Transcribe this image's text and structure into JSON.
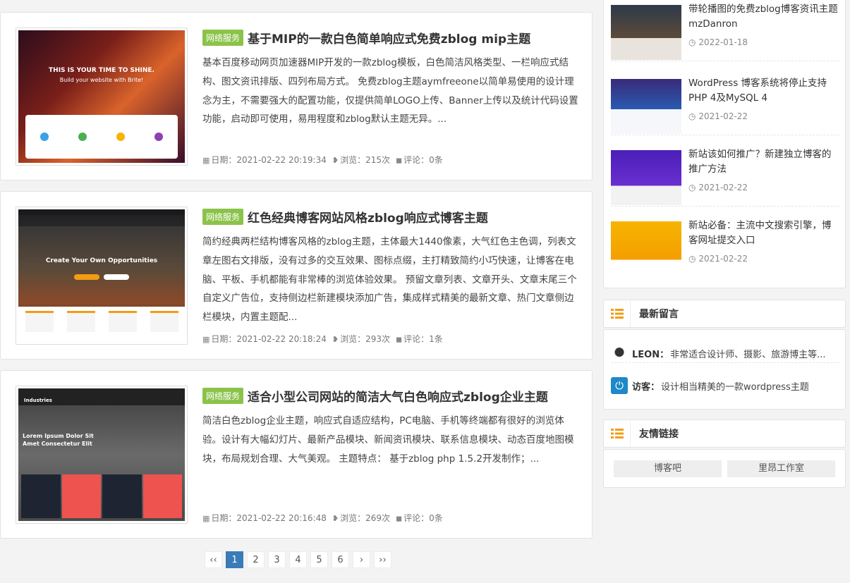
{
  "posts": [
    {
      "badge": "网络服务",
      "title": "基于MIP的一款白色简单响应式免费zblog mip主题",
      "excerpt": "基本百度移动网页加速器MIP开发的一款zblog模板，白色简洁风格类型、一栏响应式结构、图文资讯排版、四列布局方式。 免费zblog主题aymfreeone以简单易使用的设计理念为主，不需要强大的配置功能，仅提供简单LOGO上传、Banner上传以及统计代码设置功能，启动即可使用，易用程度和zblog默认主题无异。...",
      "date": "日期：2021-02-22 20:19:34",
      "views": "浏览：215次",
      "comments": "评论：0条",
      "thumb_text1": "THIS IS YOUR TIME TO SHINE.",
      "thumb_text2": "Build your website with Brite!"
    },
    {
      "badge": "网络服务",
      "title": "红色经典博客网站风格zblog响应式博客主题",
      "excerpt": "简约经典两栏结构博客风格的zblog主题，主体最大1440像素，大气红色主色调，列表文章左图右文排版，没有过多的交互效果、图标点缀，主打精致简约小巧快速，让博客在电脑、平板、手机都能有非常棒的浏览体验效果。 预留文章列表、文章开头、文章末尾三个自定义广告位，支持侧边栏新建模块添加广告，集成样式精美的最新文章、热门文章侧边栏模块，内置主题配...",
      "date": "日期：2021-02-22 20:18:24",
      "views": "浏览：293次",
      "comments": "评论：1条",
      "thumb_text1": "Create Your Own Opportunities"
    },
    {
      "badge": "网络服务",
      "title": "适合小型公司网站的简洁大气白色响应式zblog企业主题",
      "excerpt": "简洁白色zblog企业主题，响应式自适应结构，PC电脑、手机等终端都有很好的浏览体验。设计有大幅幻灯片、最新产品模块、新闻资讯模块、联系信息模块、动态百度地图模块，布局规划合理、大气美观。 主题特点： 基于zblog php 1.5.2开发制作；...",
      "date": "日期：2021-02-22 20:16:48",
      "views": "浏览：269次",
      "comments": "评论：0条",
      "thumb_text1": "Lorem Ipsum Dolor Sit Amet Consectetur Elit",
      "thumb_text2": "Industries"
    }
  ],
  "pagination": [
    "‹‹",
    "1",
    "2",
    "3",
    "4",
    "5",
    "6",
    "›",
    "››"
  ],
  "pagination_active": "1",
  "sidebar": {
    "recent": [
      {
        "title": "带轮播图的免费zblog博客资讯主题mzDanron",
        "date": "2022-01-18"
      },
      {
        "title": "WordPress 博客系统将停止支持PHP 4及MySQL 4",
        "date": "2021-02-22"
      },
      {
        "title": "新站该如何推广？新建独立博客的推广方法",
        "date": "2021-02-22"
      },
      {
        "title": "新站必备：主流中文搜索引擎，博客网址提交入口",
        "date": "2021-02-22"
      }
    ],
    "comments_title": "最新留言",
    "comments": [
      {
        "name": "LEON：",
        "text": "非常适合设计师、摄影、旅游博主等..."
      },
      {
        "name": "访客：",
        "text": "设计相当精美的一款wordpress主题"
      }
    ],
    "links_title": "友情链接",
    "links": [
      "博客吧",
      "里昂工作室"
    ]
  },
  "colors": {
    "badge": "#8bc34a",
    "accent": "#f39c12",
    "pager_active": "#3a7bb8"
  }
}
